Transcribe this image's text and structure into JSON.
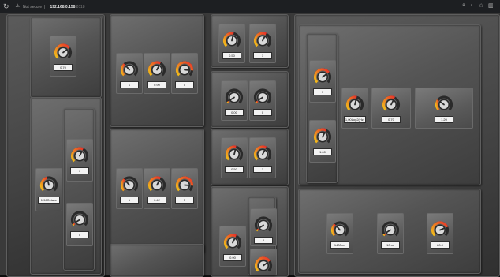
{
  "browser": {
    "reload_icon": "reload-icon",
    "security_text": "Not secure",
    "url_host": "192.168.0.158",
    "url_port": ":8118",
    "right_icons": [
      "zoom-icon",
      "share-icon",
      "star-icon",
      "sidebar-icon"
    ]
  },
  "colors": {
    "arc_red": "#e8322a",
    "arc_yellow": "#f2c21b",
    "arc_track": "#2a2a2a",
    "title_blue": "#3d8fd8"
  },
  "knobs": {
    "k1": {
      "value": "0.70",
      "level": 0.7
    },
    "k2": {
      "value": "1",
      "level": 0.35
    },
    "k3": {
      "value": "0.90",
      "level": 0.6
    },
    "k4": {
      "value": "5",
      "level": 0.85
    },
    "k5": {
      "value": "1",
      "level": 0.6
    },
    "k6": {
      "value": "1,96Octave",
      "level": 0.45
    },
    "k7": {
      "value": "0",
      "level": 0.05
    },
    "k8": {
      "value": "1",
      "level": 0.35
    },
    "k9": {
      "value": "0.42",
      "level": 0.6
    },
    "k10": {
      "value": "5",
      "level": 0.85
    },
    "k11": {
      "value": "0.50",
      "level": 0.55
    },
    "k12": {
      "value": "1",
      "level": 0.6
    },
    "k13": {
      "value": "0.00",
      "level": 0.05
    },
    "k14": {
      "value": "0",
      "level": 0.05
    },
    "k15": {
      "value": "0.50",
      "level": 0.55
    },
    "k16": {
      "value": "1",
      "level": 0.6
    },
    "k17": {
      "value": "0",
      "level": 0.05
    },
    "k18": {
      "value": "0.90",
      "level": 0.6
    },
    "k19": {
      "value": "",
      "level": 0.7
    },
    "k20": {
      "value": "1",
      "level": 0.7
    },
    "k21": {
      "value": "1.00",
      "level": 0.6
    },
    "k22": {
      "value": "1,00Log2(Hz)",
      "level": 0.55
    },
    "k23": {
      "value": "0.70",
      "level": 0.6
    },
    "k24": {
      "value": "1.20",
      "level": 0.3
    },
    "k25": {
      "value": "1400ms",
      "level": 0.35
    },
    "k26": {
      "value": "10ms",
      "level": 0.05
    },
    "k27": {
      "value": "80.0",
      "level": 0.75
    }
  }
}
